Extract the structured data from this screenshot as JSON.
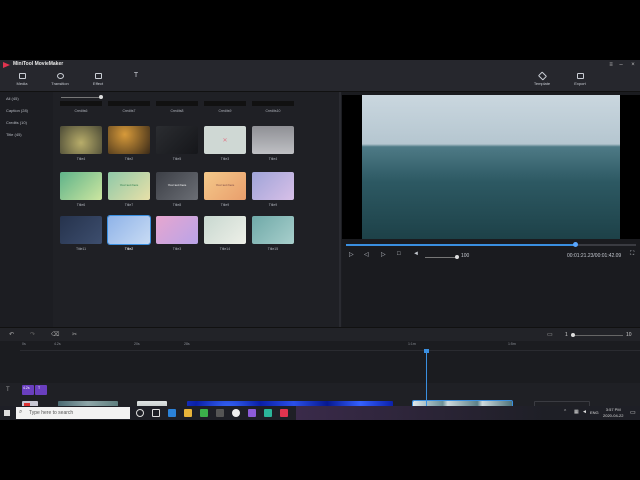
{
  "app": {
    "title": "MiniTool MovieMaker"
  },
  "toolbar": {
    "items": [
      {
        "label": "Media"
      },
      {
        "label": "Transition"
      },
      {
        "label": "Effect"
      }
    ],
    "right": [
      {
        "label": "Template"
      },
      {
        "label": "Export"
      }
    ]
  },
  "sidebar": {
    "items": [
      {
        "label": "All (45)"
      },
      {
        "label": "Caption (28)"
      },
      {
        "label": "Credits (10)"
      },
      {
        "label": "Title (45)"
      }
    ]
  },
  "media": {
    "top_row": [
      "Credits6",
      "Credits7",
      "Credits8",
      "Credits9",
      "Credits10"
    ],
    "rows": [
      [
        {
          "label": "Title4",
          "text": ""
        },
        {
          "label": "Title2",
          "text": ""
        },
        {
          "label": "Title5",
          "text": ""
        },
        {
          "label": "Title3",
          "text": ""
        },
        {
          "label": "Title4",
          "text": ""
        }
      ],
      [
        {
          "label": "Title6",
          "text": ""
        },
        {
          "label": "Title7",
          "text": "Your text here"
        },
        {
          "label": "Title8",
          "text": "Your text here"
        },
        {
          "label": "Title9",
          "text": "Your text here"
        },
        {
          "label": "Title9",
          "text": ""
        }
      ],
      [
        {
          "label": "Title11",
          "text": ""
        },
        {
          "label": "Title2",
          "text": ""
        },
        {
          "label": "Title3",
          "text": ""
        },
        {
          "label": "Title14",
          "text": ""
        },
        {
          "label": "Title15",
          "text": ""
        }
      ]
    ]
  },
  "player": {
    "volume": "100",
    "timecode": "00:01:21.23/00:01:42.09",
    "progress_fraction": 0.79
  },
  "timeline": {
    "zoom_value": "1",
    "zoom_max": "10",
    "ruler": [
      "0s",
      "4.2s",
      "20s",
      "28s",
      "1:1m",
      "1:5m"
    ],
    "caption_clip": "4.2s",
    "caption_clip2": "T"
  },
  "taskbar": {
    "search_placeholder": "Type here to search",
    "time": "3:57 PM",
    "date": "2020-04-22",
    "lang": "ENG"
  },
  "colors": {
    "accent": "#3a8fe0",
    "brand": "#e0344f",
    "caption_clip": "#6a3fbf"
  }
}
